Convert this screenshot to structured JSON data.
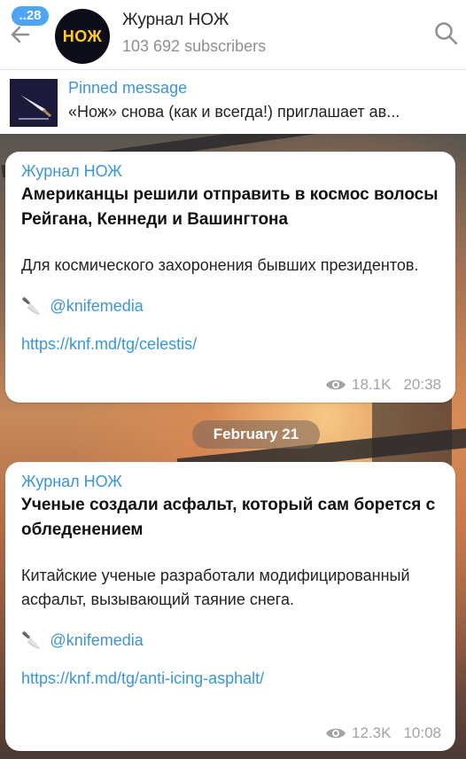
{
  "header": {
    "unread_count": "..28",
    "avatar_text": "НОЖ",
    "title": "Журнал НОЖ",
    "subscribers": "103 692 subscribers"
  },
  "pinned": {
    "title": "Pinned message",
    "text": "«Нож» снова (как и всегда!) приглашает ав..."
  },
  "messages": [
    {
      "author": "Журнал НОЖ",
      "headline": "Американцы решили отправить в космос волосы Рейгана, Кеннеди и Вашингтона",
      "text": "Для космического захоронения бывших президентов.",
      "handle_emoji": "🔪",
      "handle": "@knifemedia",
      "link": "https://knf.md/tg/celestis/",
      "views": "18.1K",
      "time": "20:38"
    },
    {
      "author": "Журнал НОЖ",
      "headline": "Ученые создали асфальт, который сам борется с обледенением",
      "text": "Китайские ученые разработали модифицированный асфальт, вызывающий таяние снега.",
      "handle_emoji": "🔪",
      "handle": "@knifemedia",
      "link": "https://knf.md/tg/anti-icing-asphalt/",
      "views": "12.3K",
      "time": "10:08"
    }
  ],
  "date_separator": "February 21",
  "colors": {
    "accent": "#3a95d6",
    "badge": "#4ea4f6",
    "avatar_bg": "#0d0d1a",
    "avatar_text": "#ffcc1f"
  }
}
